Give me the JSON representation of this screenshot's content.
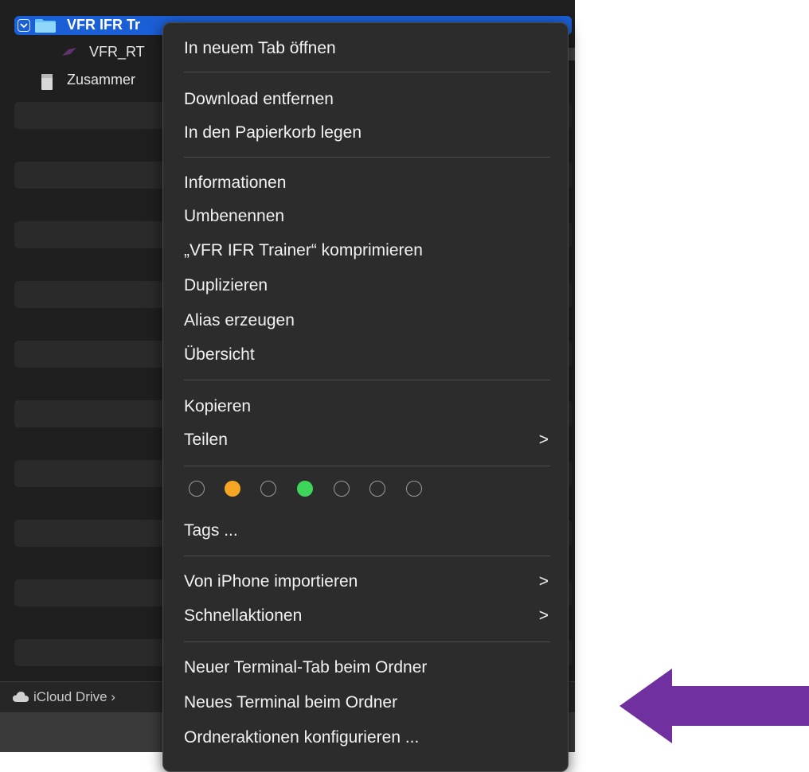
{
  "finder": {
    "rows": [
      {
        "label": "VFR IFR Tr"
      },
      {
        "label": "VFR_RT"
      },
      {
        "label": "Zusammer"
      }
    ],
    "footer_path": "iCloud Drive ›"
  },
  "context_menu": {
    "open_in_new_tab": "In neuem Tab öffnen",
    "remove_download": "Download entfernen",
    "move_to_trash": "In den Papierkorb legen",
    "get_info": "Informationen",
    "rename": "Umbenennen",
    "compress": "„VFR IFR Trainer“ komprimieren",
    "duplicate": "Duplizieren",
    "make_alias": "Alias erzeugen",
    "quick_look": "Übersicht",
    "copy": "Kopieren",
    "share": "Teilen",
    "tags": "Tags ...",
    "import_from_iphone": "Von iPhone importieren",
    "quick_actions": "Schnellaktionen",
    "new_terminal_tab": "Neuer Terminal-Tab beim Ordner",
    "new_terminal": "Neues Terminal beim Ordner",
    "folder_actions": "Ordneraktionen konfigurieren ...",
    "submenu_arrow": ">"
  },
  "tag_colors": {
    "orange": "#f5a623",
    "green": "#3fd55a"
  },
  "annotation": {
    "arrow_color": "#7030a0"
  }
}
